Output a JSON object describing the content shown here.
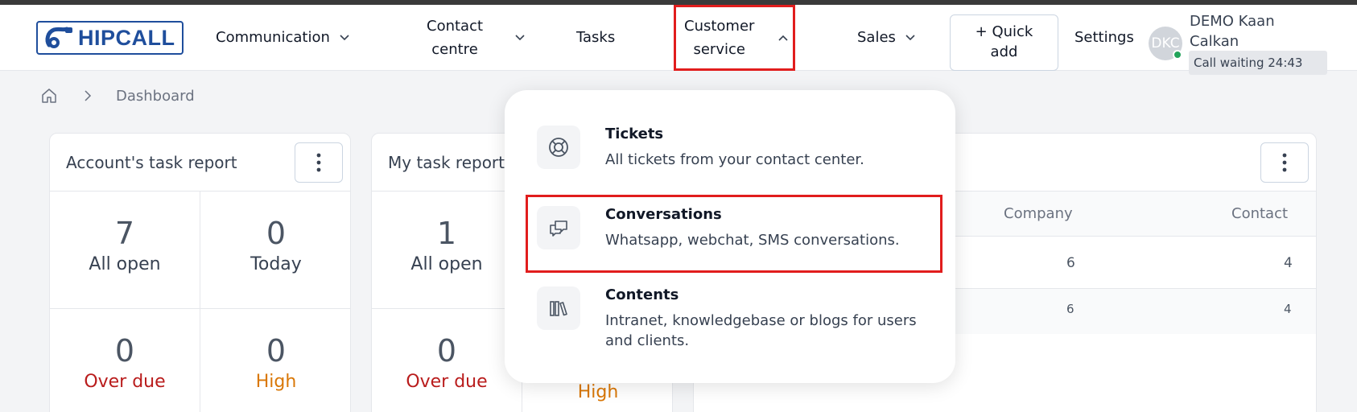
{
  "app": {
    "logo_text": "HIPCALL"
  },
  "nav": {
    "communication": "Communication",
    "contact_centre_line1": "Contact",
    "contact_centre_line2": "centre",
    "tasks": "Tasks",
    "customer_service_line1": "Customer",
    "customer_service_line2": "service",
    "sales": "Sales",
    "quick_add_line1": "+ Quick",
    "quick_add_line2": "add",
    "settings": "Settings"
  },
  "user": {
    "initials": "DKC",
    "name_line1": "DEMO Kaan",
    "name_line2": "Calkan",
    "call_status": "Call waiting 24:43"
  },
  "breadcrumb": {
    "current": "Dashboard"
  },
  "account_task_report": {
    "title": "Account's task report",
    "stats": [
      {
        "value": "7",
        "label": "All open"
      },
      {
        "value": "0",
        "label": "Today"
      },
      {
        "value": "0",
        "label": "Over due"
      },
      {
        "value": "0",
        "label": "High"
      }
    ]
  },
  "my_task_report": {
    "title": "My task report",
    "stats": [
      {
        "value": "1",
        "label": "All open"
      },
      {
        "value": "0",
        "label": "Over due"
      },
      {
        "label": "High"
      }
    ]
  },
  "third_card": {
    "columns": [
      "Company",
      "Contact"
    ],
    "rows": [
      {
        "company": "6",
        "contact": "4"
      },
      {
        "company": "6",
        "contact": "4"
      }
    ]
  },
  "customer_service_menu": {
    "items": [
      {
        "title": "Tickets",
        "desc": "All tickets from your contact center."
      },
      {
        "title": "Conversations",
        "desc": "Whatsapp, webchat, SMS conversations."
      },
      {
        "title": "Contents",
        "desc": "Intranet, knowledgebase or blogs for users and clients."
      }
    ]
  }
}
